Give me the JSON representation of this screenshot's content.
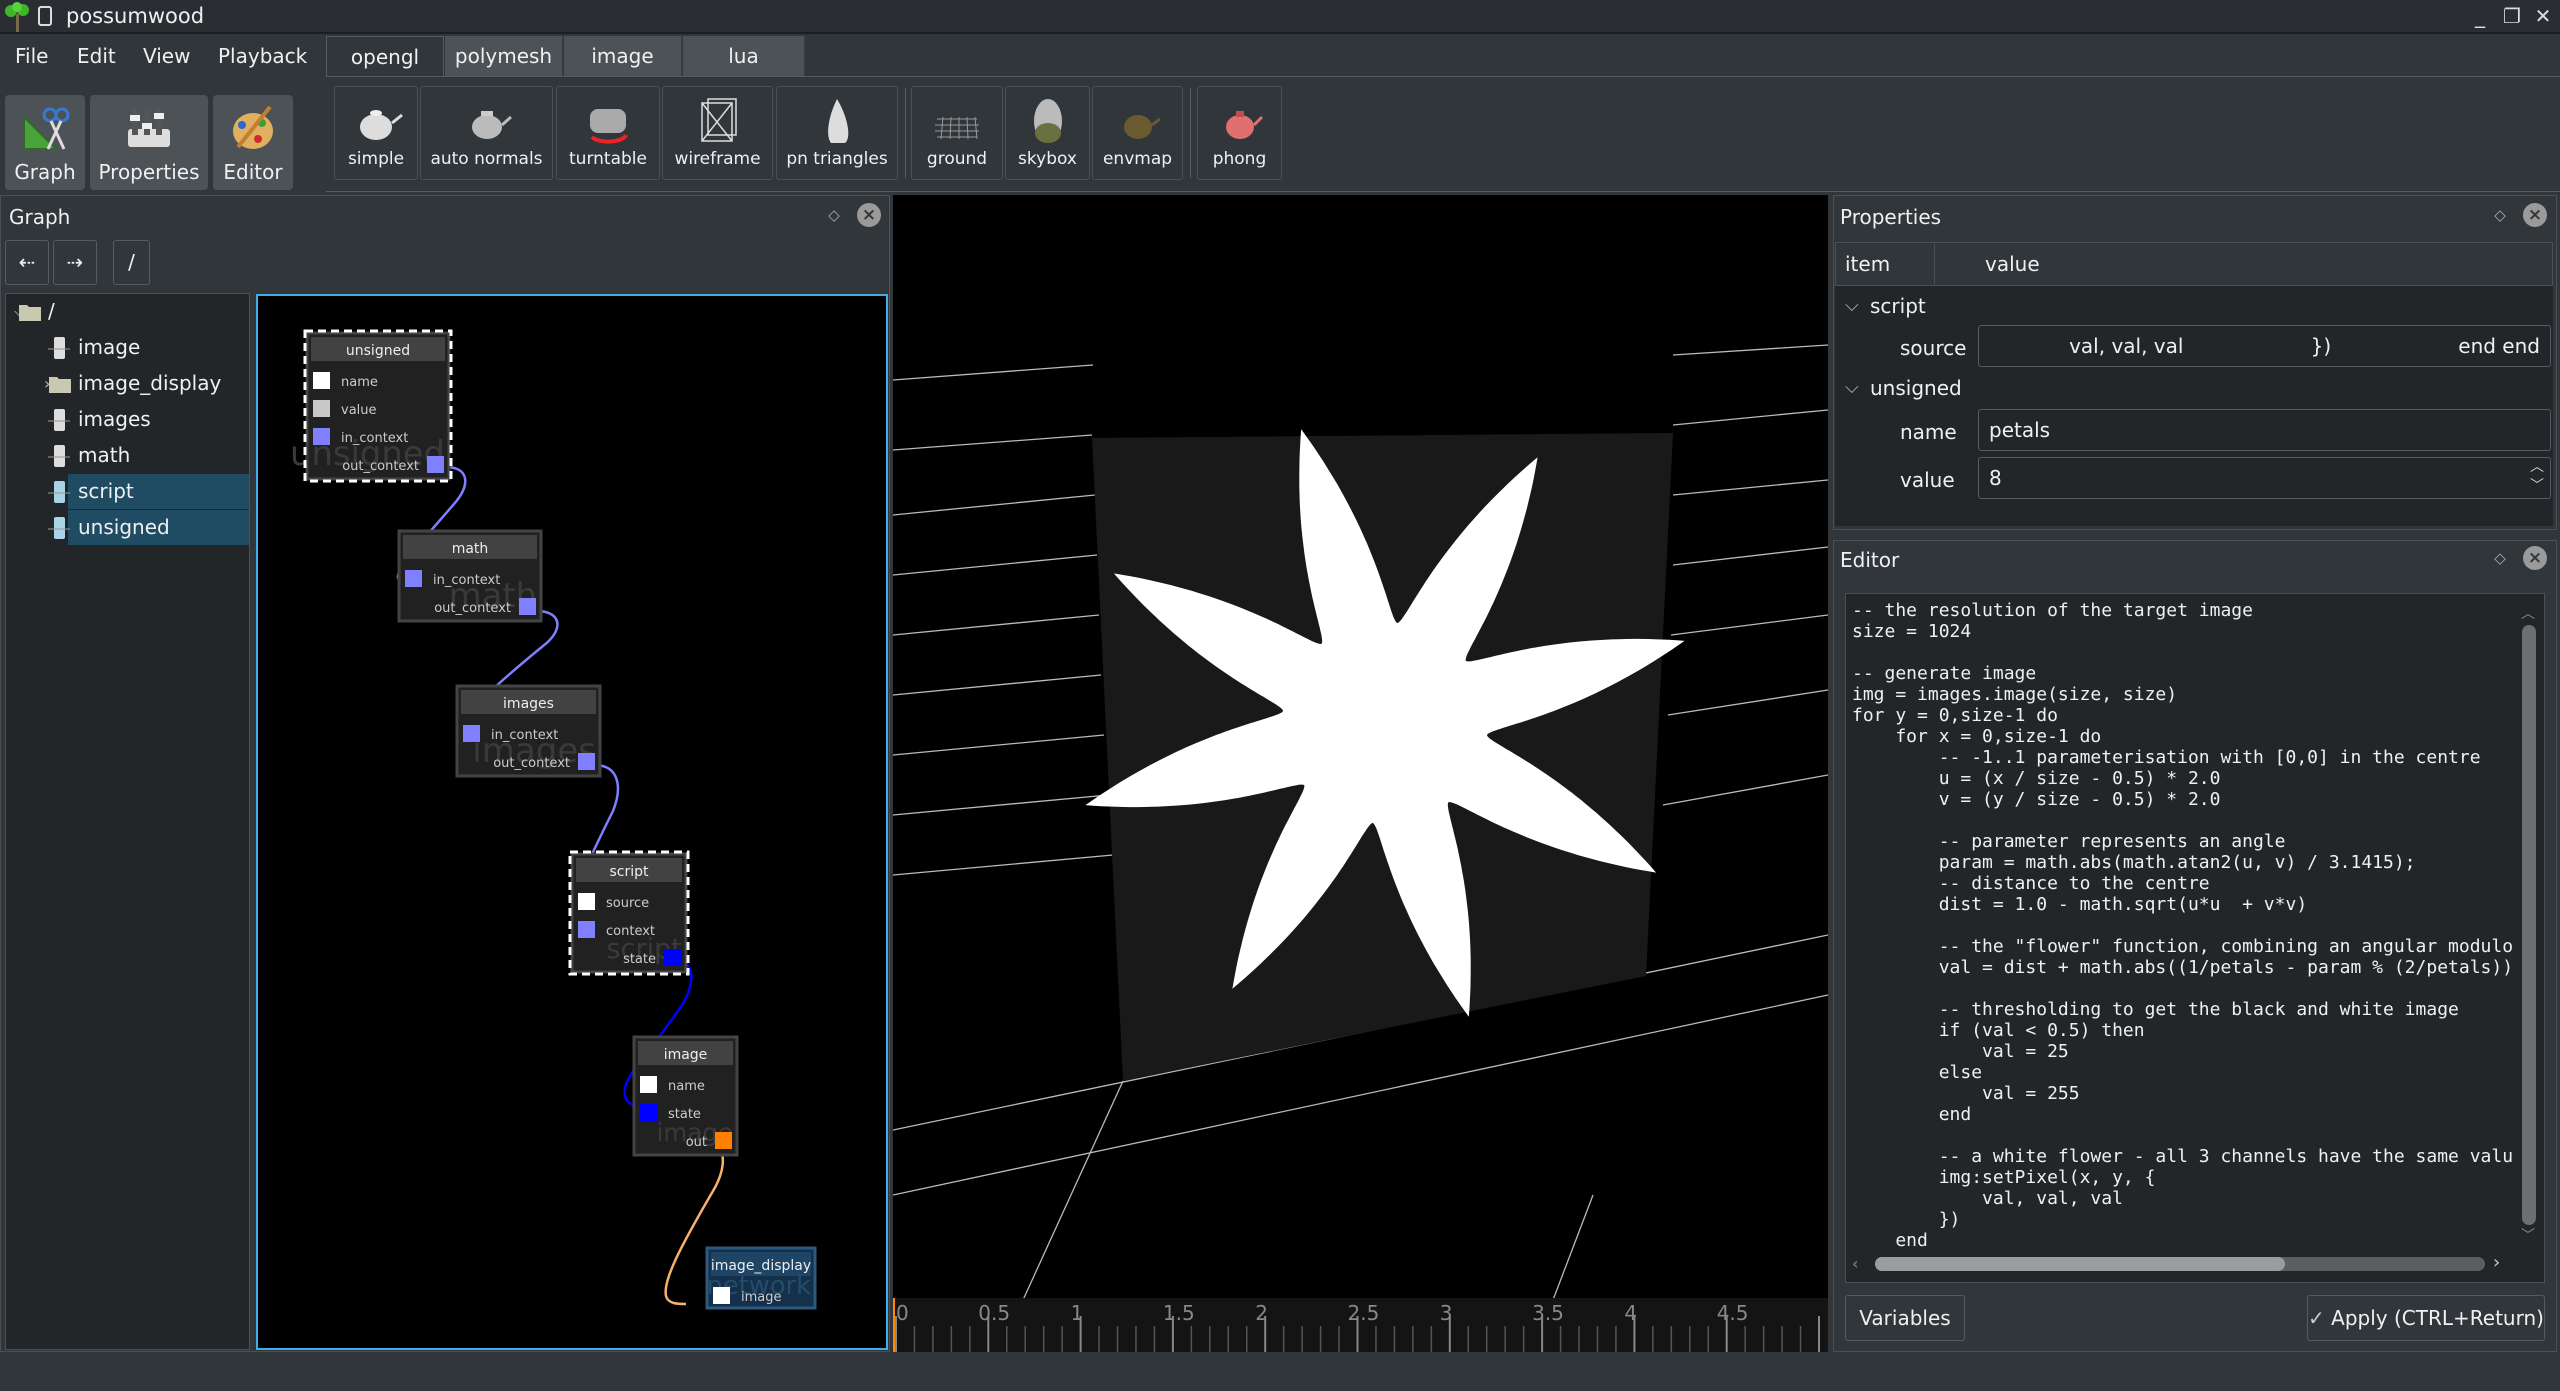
{
  "window": {
    "title": "possumwood",
    "controls": [
      "minimize",
      "maximize",
      "close"
    ]
  },
  "menu": [
    "File",
    "Edit",
    "View",
    "Playback"
  ],
  "tabs": [
    {
      "label": "opengl",
      "active": true
    },
    {
      "label": "polymesh"
    },
    {
      "label": "image"
    },
    {
      "label": "lua"
    }
  ],
  "dock_buttons": [
    {
      "label": "Graph",
      "icon": "graph-icon"
    },
    {
      "label": "Properties",
      "icon": "properties-icon"
    },
    {
      "label": "Editor",
      "icon": "editor-icon"
    }
  ],
  "toolbar": [
    {
      "label": "simple",
      "icon": "teapot-icon"
    },
    {
      "label": "auto normals",
      "icon": "teapot-normals-icon"
    },
    {
      "label": "turntable",
      "icon": "turntable-icon"
    },
    {
      "label": "wireframe",
      "icon": "wireframe-icon"
    },
    {
      "label": "pn triangles",
      "icon": "pn-triangles-icon"
    },
    {
      "label": "ground",
      "icon": "ground-icon"
    },
    {
      "label": "skybox",
      "icon": "skybox-icon"
    },
    {
      "label": "envmap",
      "icon": "envmap-icon"
    },
    {
      "label": "phong",
      "icon": "phong-icon"
    }
  ],
  "graph_panel": {
    "title": "Graph",
    "path": "/",
    "tree": [
      {
        "label": "/",
        "type": "folder",
        "expanded": true
      },
      {
        "label": "image",
        "type": "node"
      },
      {
        "label": "image_display",
        "type": "folder",
        "expanded": false
      },
      {
        "label": "images",
        "type": "node"
      },
      {
        "label": "math",
        "type": "node"
      },
      {
        "label": "script",
        "type": "node",
        "selected": true
      },
      {
        "label": "unsigned",
        "type": "node",
        "selected": true
      }
    ],
    "nodes": [
      {
        "title": "unsigned",
        "watermark": "unsigned",
        "selected": true,
        "ports": [
          {
            "name": "name",
            "color": "#ffffff"
          },
          {
            "name": "value",
            "color": "#c8c8c8"
          },
          {
            "name": "in_context",
            "color": "#7f7fff"
          },
          {
            "name": "out_context",
            "color": "#7f7fff",
            "out": true
          }
        ]
      },
      {
        "title": "math",
        "watermark": "math",
        "ports": [
          {
            "name": "in_context",
            "color": "#7f7fff"
          },
          {
            "name": "out_context",
            "color": "#7f7fff",
            "out": true
          }
        ]
      },
      {
        "title": "images",
        "watermark": "images",
        "ports": [
          {
            "name": "in_context",
            "color": "#7f7fff"
          },
          {
            "name": "out_context",
            "color": "#7f7fff",
            "out": true
          }
        ]
      },
      {
        "title": "script",
        "watermark": "script",
        "selected": true,
        "ports": [
          {
            "name": "source",
            "color": "#ffffff"
          },
          {
            "name": "context",
            "color": "#7f7fff"
          },
          {
            "name": "state",
            "color": "#0000ff",
            "out": true
          }
        ]
      },
      {
        "title": "image",
        "watermark": "image",
        "ports": [
          {
            "name": "name",
            "color": "#ffffff"
          },
          {
            "name": "state",
            "color": "#0000ff"
          },
          {
            "name": "out",
            "color": "#ff7f00",
            "out": true
          }
        ]
      },
      {
        "title": "image_display",
        "watermark": "network",
        "network": true,
        "ports": [
          {
            "name": "image",
            "color": "#ffffff"
          }
        ]
      }
    ]
  },
  "timeline": {
    "labels": [
      "0",
      "0.5",
      "1",
      "1.5",
      "2",
      "2.5",
      "3",
      "3.5",
      "4",
      "4.5"
    ],
    "current": 0
  },
  "properties": {
    "title": "Properties",
    "columns": [
      "item",
      "value"
    ],
    "groups": [
      {
        "label": "script",
        "rows": [
          {
            "item": "source",
            "value": "val, val, val                    })                    end end"
          }
        ]
      },
      {
        "label": "unsigned",
        "rows": [
          {
            "item": "name",
            "value": "petals"
          },
          {
            "item": "value",
            "value": "8"
          }
        ]
      }
    ]
  },
  "editor": {
    "title": "Editor",
    "code": [
      "-- the resolution of the target image",
      "size = 1024",
      "",
      "-- generate image",
      "img = images.image(size, size)",
      "for y = 0,size-1 do",
      "    for x = 0,size-1 do",
      "        -- -1..1 parameterisation with [0,0] in the centre",
      "        u = (x / size - 0.5) * 2.0",
      "        v = (y / size - 0.5) * 2.0",
      "",
      "        -- parameter represents an angle",
      "        param = math.abs(math.atan2(u, v) / 3.1415);",
      "        -- distance to the centre",
      "        dist = 1.0 - math.sqrt(u*u  + v*v)",
      "",
      "        -- the \"flower\" function, combining an angular modulo",
      "        val = dist + math.abs((1/petals - param % (2/petals))",
      "",
      "        -- thresholding to get the black and white image",
      "        if (val < 0.5) then",
      "            val = 25",
      "        else",
      "            val = 255",
      "        end",
      "",
      "        -- a white flower - all 3 channels have the same valu",
      "        img:setPixel(x, y, {",
      "            val, val, val",
      "        })",
      "    end"
    ],
    "variables_label": "Variables",
    "apply_label": "Apply (CTRL+Return)"
  },
  "colors": {
    "accent": "#3daee9",
    "selection": "#1f4c63",
    "context_port": "#7f7fff",
    "state_port": "#0000ff",
    "image_port": "#ff7f00"
  }
}
